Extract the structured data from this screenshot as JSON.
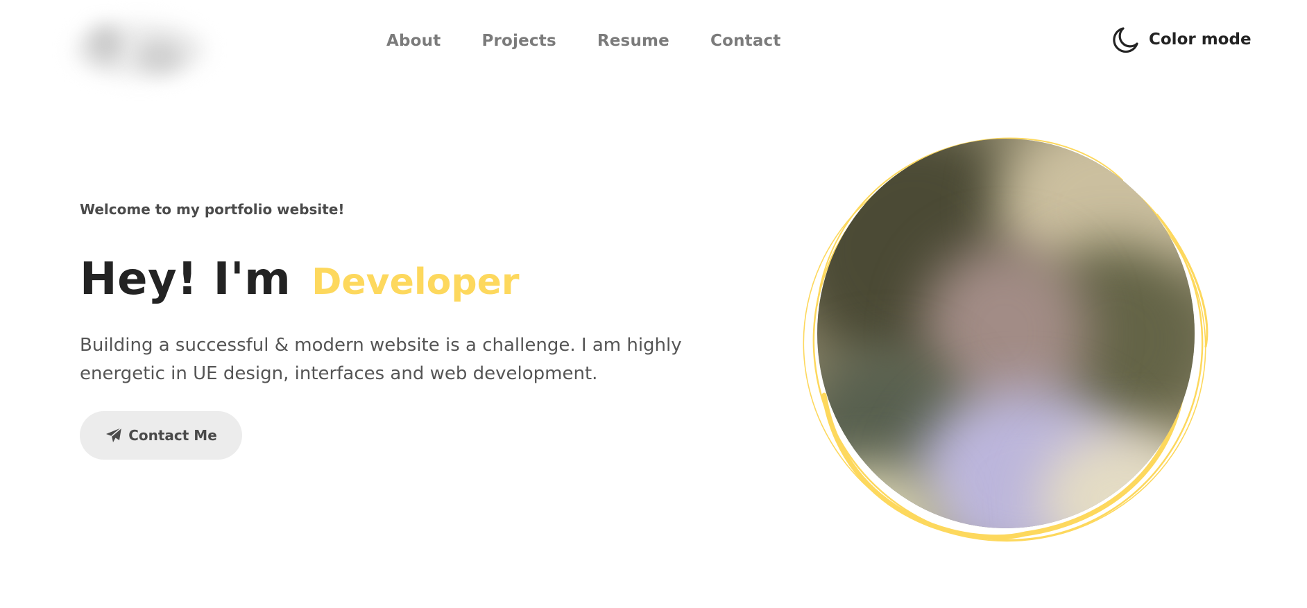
{
  "header": {
    "logo": {
      "icon": "logo-mark"
    },
    "nav": [
      {
        "label": "About"
      },
      {
        "label": "Projects"
      },
      {
        "label": "Resume"
      },
      {
        "label": "Contact"
      }
    ],
    "color_mode": {
      "label": "Color mode",
      "icon": "moon-icon"
    }
  },
  "hero": {
    "eyebrow": "Welcome to my portfolio website!",
    "greeting": "Hey! I'm",
    "role": "Developer",
    "description": "Building a successful & modern website is a challenge. I am highly energetic in UE design, interfaces and web development.",
    "cta": {
      "label": "Contact Me",
      "icon": "paper-plane-icon"
    }
  },
  "portrait": {
    "icon": "profile-photo"
  },
  "colors": {
    "accent": "#fdd85d",
    "text": "#232323",
    "muted": "#7b7b7b",
    "button_bg": "#ececec"
  }
}
